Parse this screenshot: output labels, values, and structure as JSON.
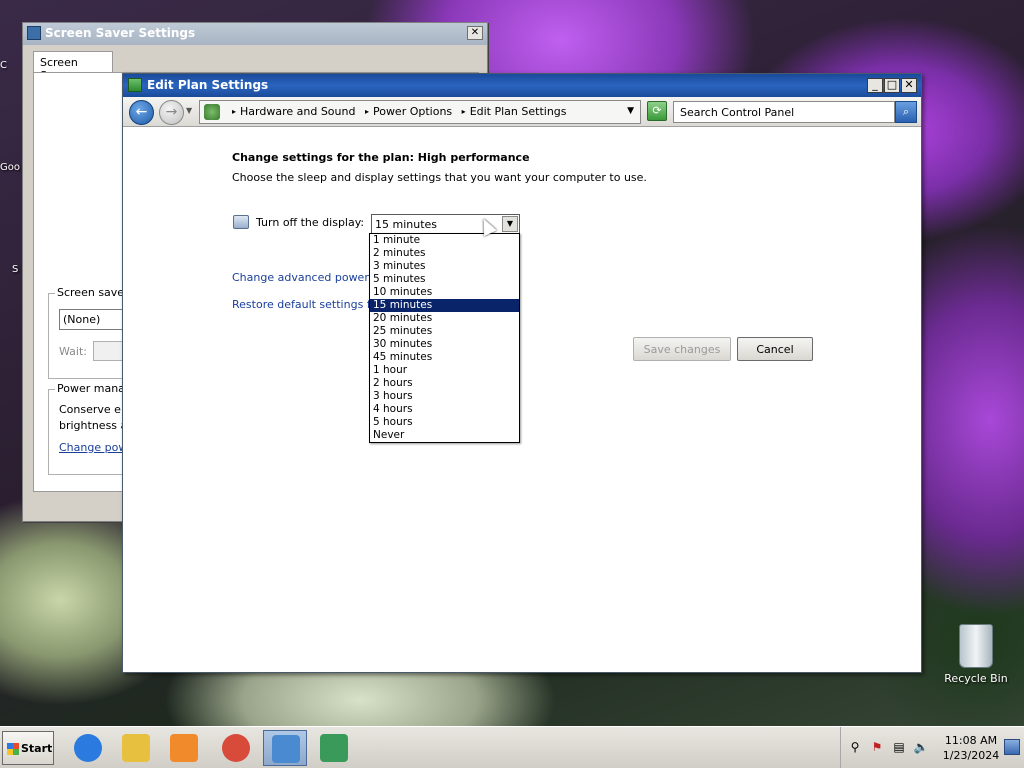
{
  "desktop": {
    "recycle_bin_label": "Recycle Bin",
    "partial_icon_labels": [
      "C",
      "Goo",
      "S"
    ]
  },
  "screen_saver_window": {
    "title": "Screen Saver Settings",
    "close_label": "✕",
    "tab_label": "Screen Saver",
    "screen_saver_group_label": "Screen saver",
    "screen_saver_value": "(None)",
    "wait_label": "Wait:",
    "power_group_label": "Power mana",
    "power_text_line1": "Conserve en",
    "power_text_line2": "brightness a",
    "power_link": "Change pow"
  },
  "edit_plan_window": {
    "title": "Edit Plan Settings",
    "controls": {
      "minimize": "_",
      "maximize": "□",
      "close": "✕"
    },
    "nav": {
      "back_glyph": "←",
      "forward_glyph": "→",
      "history_glyph": "▼",
      "breadcrumbs": [
        "Hardware and Sound",
        "Power Options",
        "Edit Plan Settings"
      ],
      "crumb_separator": "▸",
      "address_dropdown_glyph": "▼",
      "refresh_glyph": "⟳",
      "search_placeholder": "Search Control Panel",
      "search_glyph": "⌕"
    },
    "heading": "Change settings for the plan: High performance",
    "subheading": "Choose the sleep and display settings that you want your computer to use.",
    "display_label": "Turn off the display:",
    "display_value": "15 minutes",
    "combo_arrow_glyph": "▼",
    "advanced_link": "Change advanced power set",
    "restore_link": "Restore default settings for t",
    "save_button": "Save changes",
    "cancel_button": "Cancel",
    "dropdown_options": [
      "1 minute",
      "2 minutes",
      "3 minutes",
      "5 minutes",
      "10 minutes",
      "15 minutes",
      "20 minutes",
      "25 minutes",
      "30 minutes",
      "45 minutes",
      "1 hour",
      "2 hours",
      "3 hours",
      "4 hours",
      "5 hours",
      "Never"
    ],
    "selected_option": "15 minutes"
  },
  "taskbar": {
    "start_label": "Start",
    "apps": [
      {
        "icon": "internet-explorer-icon",
        "color": "#2a7ae0"
      },
      {
        "icon": "file-explorer-icon",
        "color": "#e8c040"
      },
      {
        "icon": "media-player-icon",
        "color": "#f08a2a"
      },
      {
        "icon": "chrome-icon",
        "color": "#d84a3a"
      },
      {
        "icon": "control-panel-icon",
        "color": "#4a8ad0"
      },
      {
        "icon": "display-settings-icon",
        "color": "#3a9a5a"
      }
    ],
    "tray": {
      "time": "11:08 AM",
      "date": "1/23/2024",
      "icons": {
        "search": "⚲",
        "action_center": "⚑",
        "network": "▤",
        "volume": "🔈"
      }
    }
  }
}
